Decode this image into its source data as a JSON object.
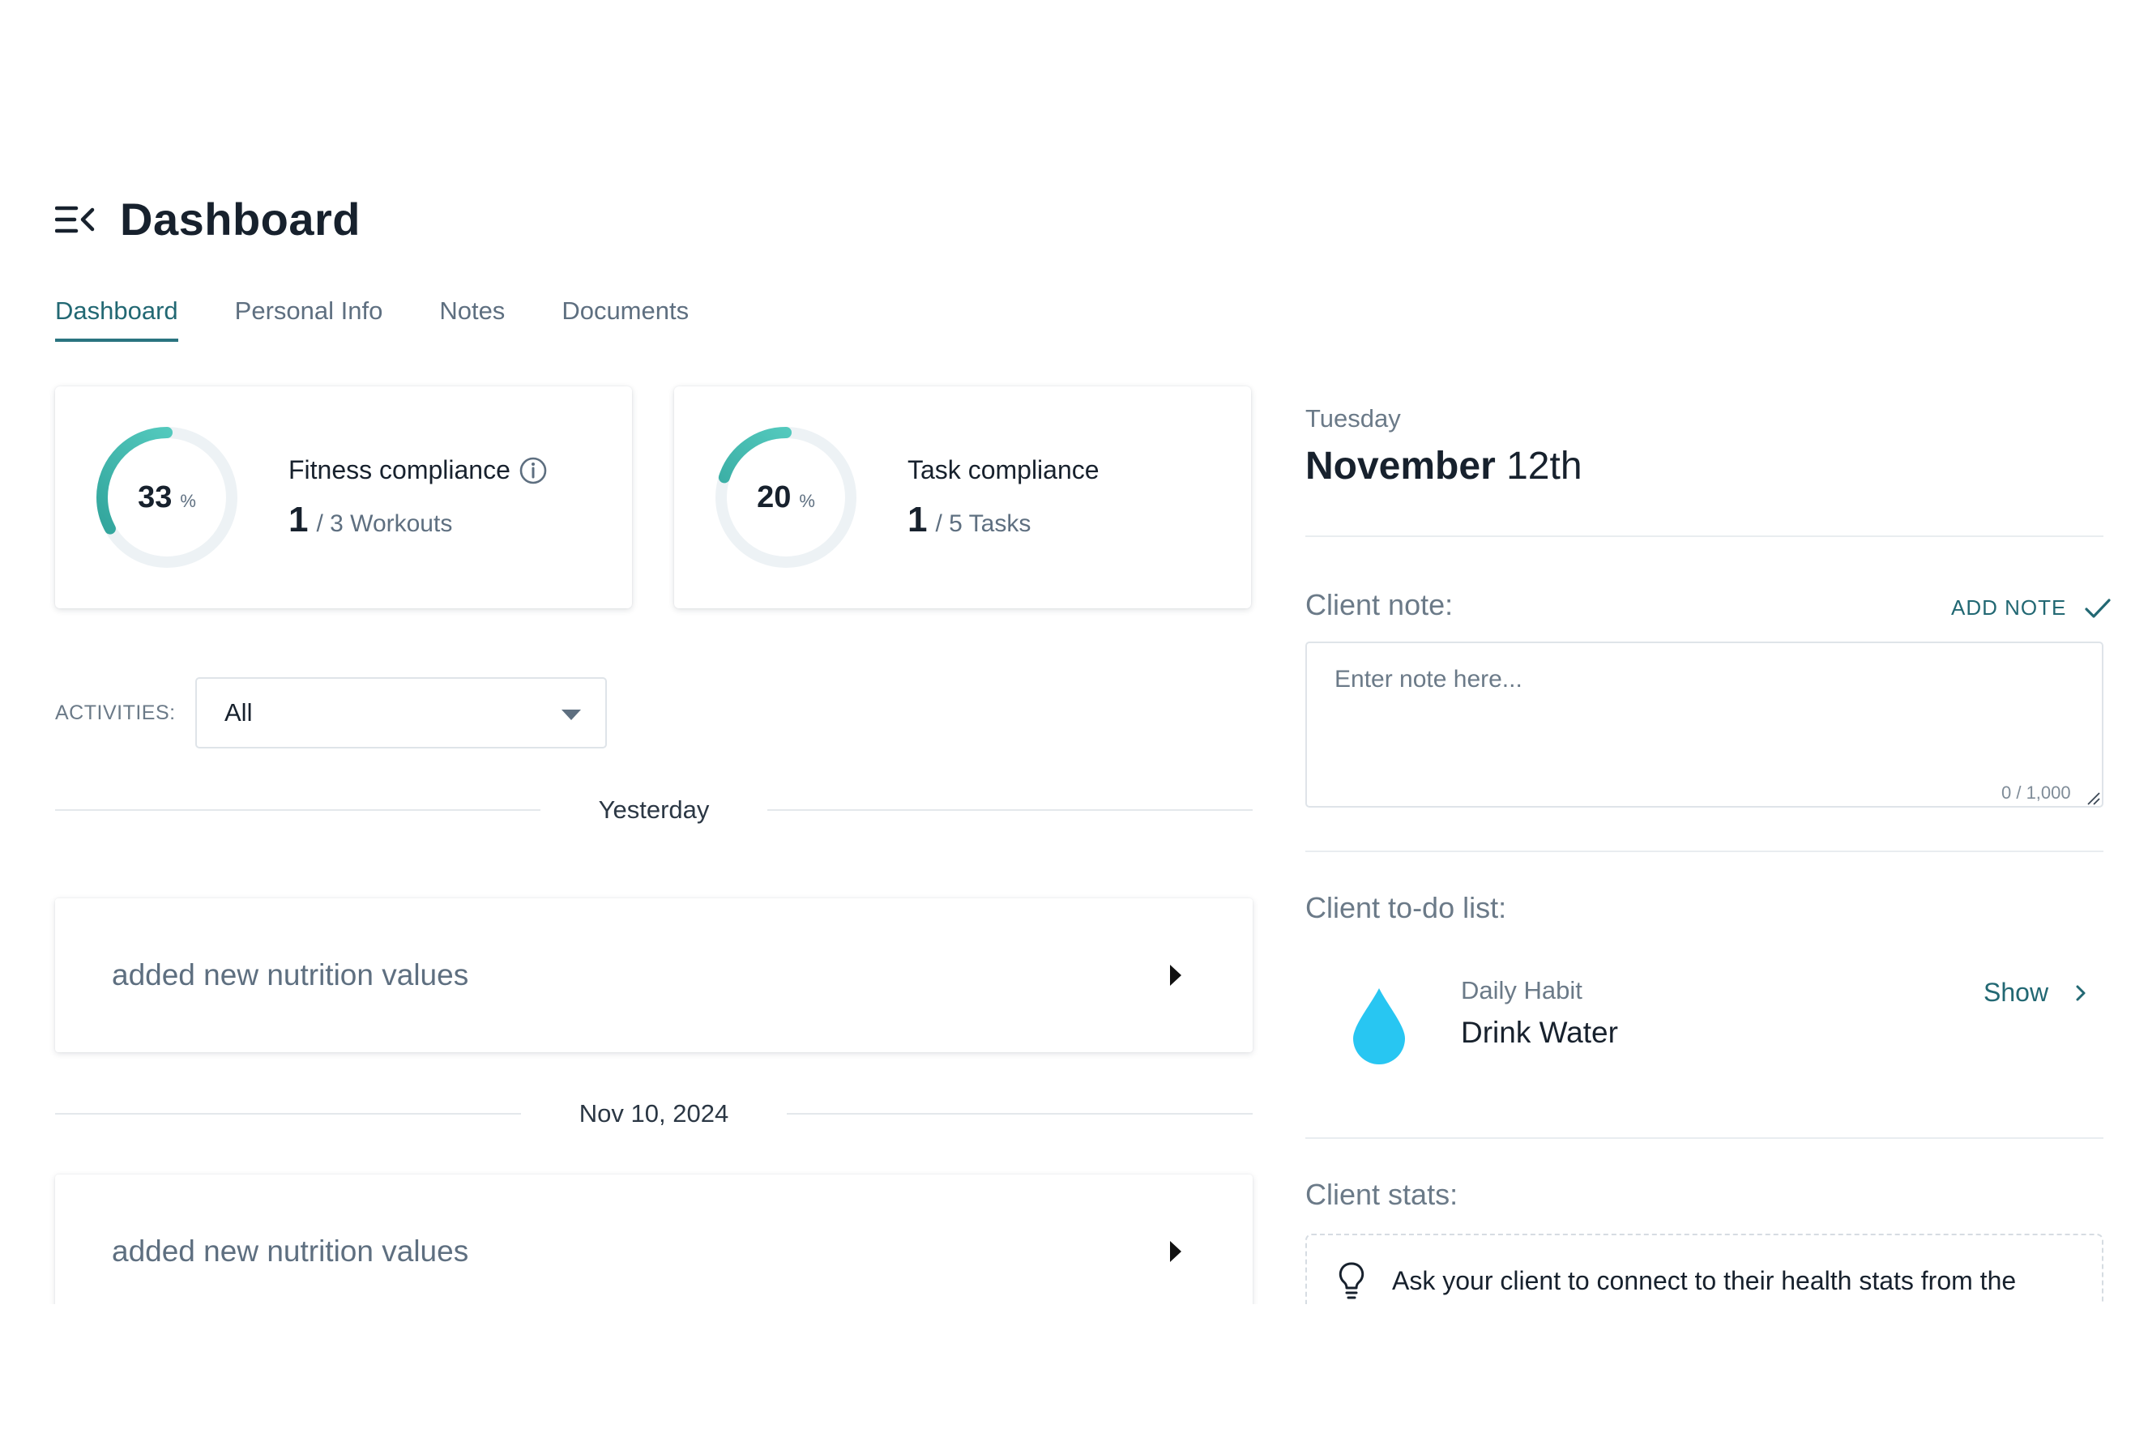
{
  "header": {
    "title": "Dashboard",
    "menu_icon": "menu-collapse-icon"
  },
  "tabs": [
    {
      "label": "Dashboard",
      "active": true
    },
    {
      "label": "Personal Info",
      "active": false
    },
    {
      "label": "Notes",
      "active": false
    },
    {
      "label": "Documents",
      "active": false
    }
  ],
  "compliance": {
    "fitness": {
      "percent": "33",
      "percent_symbol": "%",
      "progress": 0.33,
      "title": "Fitness compliance",
      "count": "1",
      "total_label": "/ 3 Workouts",
      "info_icon": "info-icon"
    },
    "task": {
      "percent": "20",
      "percent_symbol": "%",
      "progress": 0.2,
      "title": "Task compliance",
      "count": "1",
      "total_label": "/ 5 Tasks"
    }
  },
  "activities_filter": {
    "label": "ACTIVITIES:",
    "selected": "All"
  },
  "feed": [
    {
      "date_label": "Yesterday",
      "text": "added new nutrition values"
    },
    {
      "date_label": "Nov 10, 2024",
      "text": "added new nutrition values"
    }
  ],
  "right": {
    "weekday": "Tuesday",
    "date_month": "November",
    "date_day": "12th",
    "client_note": {
      "label": "Client note:",
      "add_label": "ADD NOTE",
      "placeholder": "Enter note here...",
      "char_count": "0 / 1,000"
    },
    "todo": {
      "label": "Client to-do list:",
      "item_type": "Daily Habit",
      "item_name": "Drink Water",
      "show_label": "Show",
      "icon": "water-drop-icon"
    },
    "stats": {
      "label": "Client stats:",
      "hint": "Ask your client to connect to their health stats from the",
      "icon": "lightbulb-icon"
    }
  },
  "colors": {
    "accent": "#2a7480",
    "ring_start": "#4fd1c5",
    "ring_end": "#2c9e96",
    "ring_track": "#edf2f5",
    "water": "#28c6f2"
  }
}
